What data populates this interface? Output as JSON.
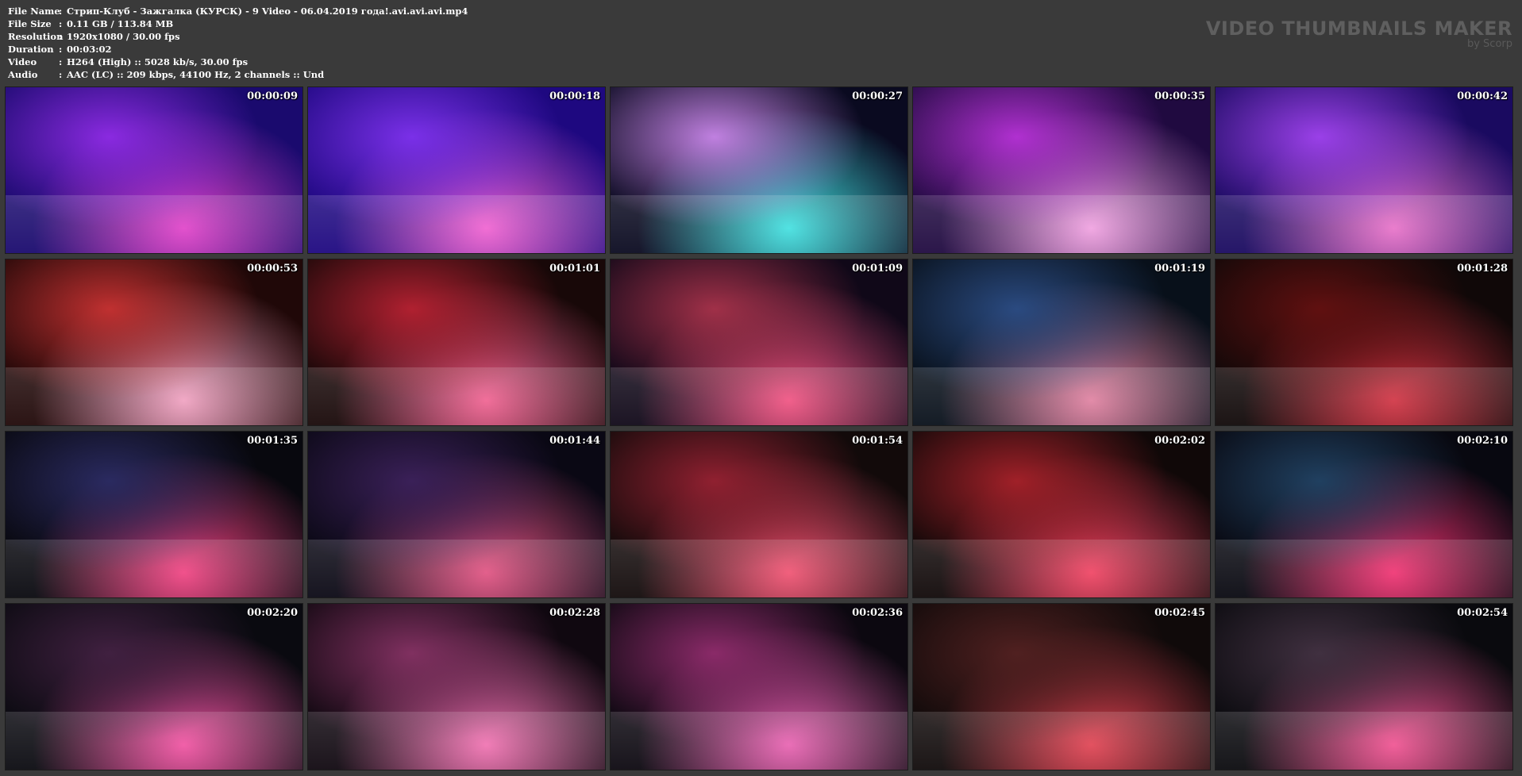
{
  "info": [
    {
      "key": "File Name",
      "value": "Стрип-Клуб - Зажгалка (КУРСК) - 9 Video - 06.04.2019 года!.avi.avi.avi.mp4"
    },
    {
      "key": "File Size",
      "value": "0.11 GB  / 113.84 MB"
    },
    {
      "key": "Resolution",
      "value": "1920x1080 / 30.00 fps"
    },
    {
      "key": "Duration",
      "value": "00:03:02"
    },
    {
      "key": "Video",
      "value": "H264 (High) :: 5028 kb/s, 30.00 fps"
    },
    {
      "key": "Audio",
      "value": "AAC (LC) :: 209 kbps, 44100 Hz, 2 channels :: Und"
    }
  ],
  "brand": {
    "title": "VIDEO THUMBNAILS MAKER",
    "subtitle": "by Scorp"
  },
  "thumbnails": [
    {
      "time": "00:00:09",
      "colors": [
        "#1a0a6e",
        "#8a2ae0",
        "#e040c8"
      ]
    },
    {
      "time": "00:00:18",
      "colors": [
        "#1e0880",
        "#7a30e8",
        "#f060d0"
      ]
    },
    {
      "time": "00:00:27",
      "colors": [
        "#0a0a20",
        "#c080e0",
        "#40e0e0"
      ]
    },
    {
      "time": "00:00:35",
      "colors": [
        "#200a40",
        "#b030d0",
        "#f0a0e0"
      ]
    },
    {
      "time": "00:00:42",
      "colors": [
        "#1a0a60",
        "#9a40e8",
        "#e870c8"
      ]
    },
    {
      "time": "00:00:53",
      "colors": [
        "#200808",
        "#c03030",
        "#f0a0c0"
      ]
    },
    {
      "time": "00:01:01",
      "colors": [
        "#180808",
        "#b02030",
        "#f06090"
      ]
    },
    {
      "time": "00:01:09",
      "colors": [
        "#100818",
        "#a03048",
        "#f05080"
      ]
    },
    {
      "time": "00:01:19",
      "colors": [
        "#08101a",
        "#2a4a80",
        "#e080a0"
      ]
    },
    {
      "time": "00:01:28",
      "colors": [
        "#100808",
        "#601010",
        "#d03040"
      ]
    },
    {
      "time": "00:01:35",
      "colors": [
        "#08080e",
        "#2a2a60",
        "#f04080"
      ]
    },
    {
      "time": "00:01:44",
      "colors": [
        "#0a0814",
        "#3a2058",
        "#e05080"
      ]
    },
    {
      "time": "00:01:54",
      "colors": [
        "#120a0a",
        "#902030",
        "#f05070"
      ]
    },
    {
      "time": "00:02:02",
      "colors": [
        "#100808",
        "#a02028",
        "#f04060"
      ]
    },
    {
      "time": "00:02:10",
      "colors": [
        "#080810",
        "#204060",
        "#f03070"
      ]
    },
    {
      "time": "00:02:20",
      "colors": [
        "#0a0a10",
        "#402040",
        "#f050a0"
      ]
    },
    {
      "time": "00:02:28",
      "colors": [
        "#100810",
        "#803060",
        "#f070b0"
      ]
    },
    {
      "time": "00:02:36",
      "colors": [
        "#0c0810",
        "#8a2a68",
        "#e860b0"
      ]
    },
    {
      "time": "00:02:45",
      "colors": [
        "#100a0a",
        "#502020",
        "#e04050"
      ]
    },
    {
      "time": "00:02:54",
      "colors": [
        "#0a0a0e",
        "#403040",
        "#f05090"
      ]
    }
  ]
}
